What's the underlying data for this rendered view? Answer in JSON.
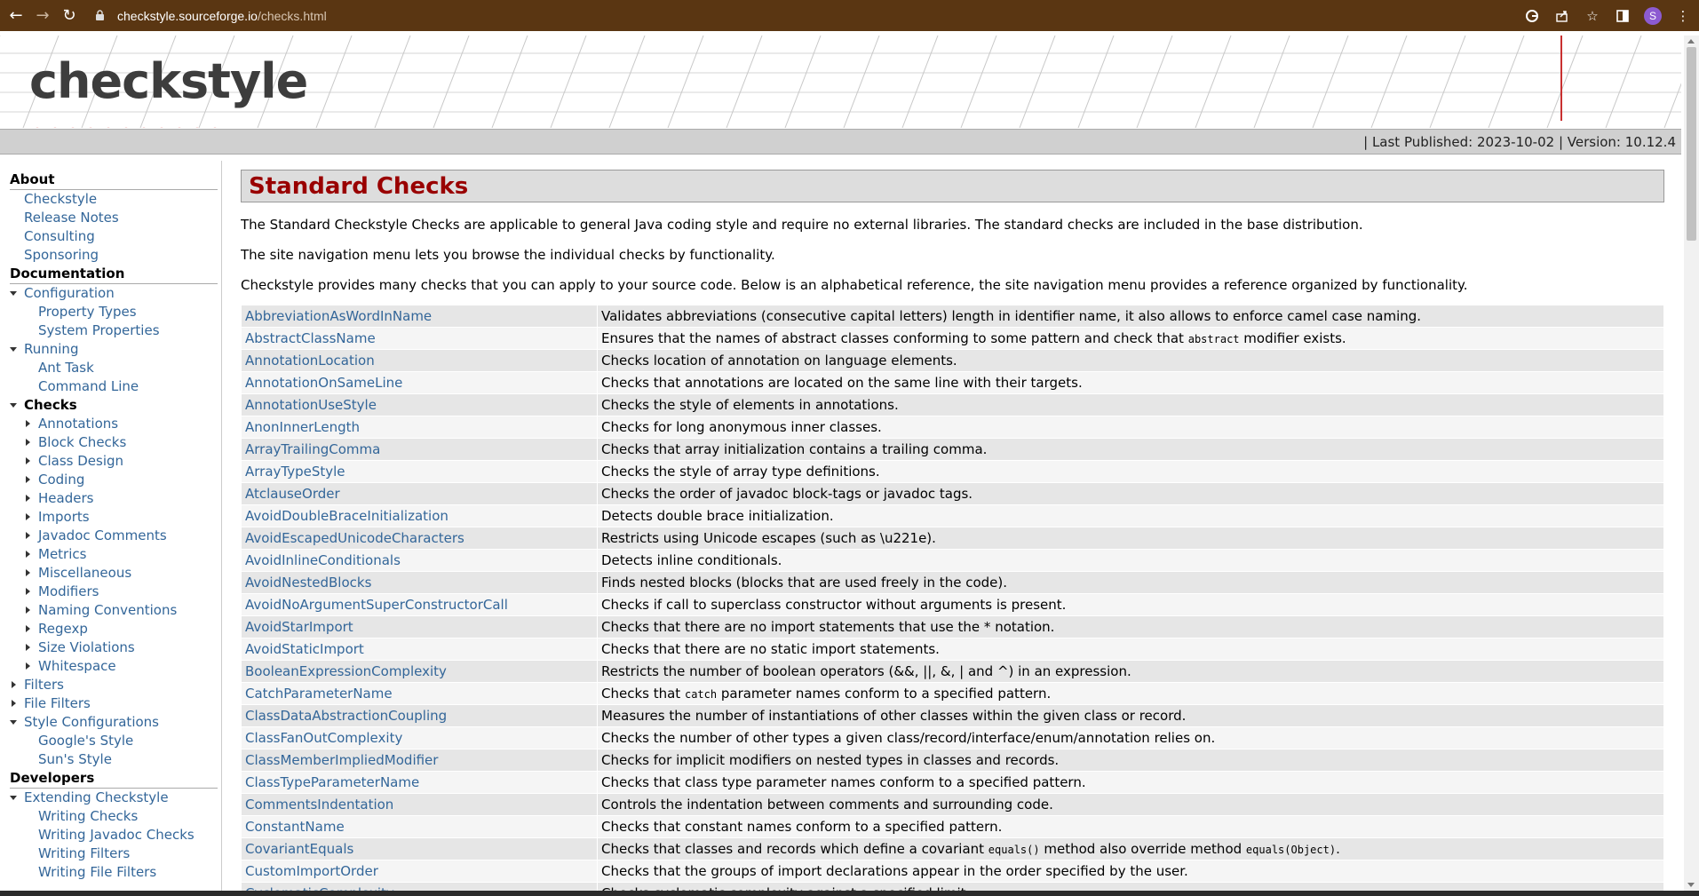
{
  "browser": {
    "url_host": "checkstyle.sourceforge.io",
    "url_path": "/checks.html",
    "avatar_letter": "S"
  },
  "header": {
    "logo_text": "checkstyle",
    "published": "| Last Published: 2023-10-02 | Version: 10.12.4"
  },
  "sidebar": {
    "sections": [
      {
        "title": "About",
        "items": [
          {
            "label": "Checkstyle",
            "level": 1
          },
          {
            "label": "Release Notes",
            "level": 1
          },
          {
            "label": "Consulting",
            "level": 1
          },
          {
            "label": "Sponsoring",
            "level": 1
          }
        ]
      },
      {
        "title": "Documentation",
        "items": [
          {
            "label": "Configuration",
            "level": 1,
            "toggle": "open"
          },
          {
            "label": "Property Types",
            "level": 2
          },
          {
            "label": "System Properties",
            "level": 2
          },
          {
            "label": "Running",
            "level": 1,
            "toggle": "open"
          },
          {
            "label": "Ant Task",
            "level": 2
          },
          {
            "label": "Command Line",
            "level": 2
          },
          {
            "label": "Checks",
            "level": 1,
            "toggle": "open",
            "active": true
          },
          {
            "label": "Annotations",
            "level": 2,
            "toggle": "closed"
          },
          {
            "label": "Block Checks",
            "level": 2,
            "toggle": "closed"
          },
          {
            "label": "Class Design",
            "level": 2,
            "toggle": "closed"
          },
          {
            "label": "Coding",
            "level": 2,
            "toggle": "closed"
          },
          {
            "label": "Headers",
            "level": 2,
            "toggle": "closed"
          },
          {
            "label": "Imports",
            "level": 2,
            "toggle": "closed"
          },
          {
            "label": "Javadoc Comments",
            "level": 2,
            "toggle": "closed"
          },
          {
            "label": "Metrics",
            "level": 2,
            "toggle": "closed"
          },
          {
            "label": "Miscellaneous",
            "level": 2,
            "toggle": "closed"
          },
          {
            "label": "Modifiers",
            "level": 2,
            "toggle": "closed"
          },
          {
            "label": "Naming Conventions",
            "level": 2,
            "toggle": "closed"
          },
          {
            "label": "Regexp",
            "level": 2,
            "toggle": "closed"
          },
          {
            "label": "Size Violations",
            "level": 2,
            "toggle": "closed"
          },
          {
            "label": "Whitespace",
            "level": 2,
            "toggle": "closed"
          },
          {
            "label": "Filters",
            "level": 1,
            "toggle": "closed"
          },
          {
            "label": "File Filters",
            "level": 1,
            "toggle": "closed"
          },
          {
            "label": "Style Configurations",
            "level": 1,
            "toggle": "open"
          },
          {
            "label": "Google's Style",
            "level": 2
          },
          {
            "label": "Sun's Style",
            "level": 2
          }
        ]
      },
      {
        "title": "Developers",
        "items": [
          {
            "label": "Extending Checkstyle",
            "level": 1,
            "toggle": "open"
          },
          {
            "label": "Writing Checks",
            "level": 2
          },
          {
            "label": "Writing Javadoc Checks",
            "level": 2
          },
          {
            "label": "Writing Filters",
            "level": 2
          },
          {
            "label": "Writing File Filters",
            "level": 2
          }
        ]
      }
    ]
  },
  "main": {
    "title": "Standard Checks",
    "intro1": "The Standard Checkstyle Checks are applicable to general Java coding style and require no external libraries. The standard checks are included in the base distribution.",
    "intro2": "The site navigation menu lets you browse the individual checks by functionality.",
    "intro3": "Checkstyle provides many checks that you can apply to your source code. Below is an alphabetical reference, the site navigation menu provides a reference organized by functionality.",
    "checks": [
      {
        "name": "AbbreviationAsWordInName",
        "desc": [
          "Validates abbreviations (consecutive capital letters) length in identifier name, it also allows to enforce camel case naming."
        ]
      },
      {
        "name": "AbstractClassName",
        "desc": [
          "Ensures that the names of abstract classes conforming to some pattern and check that ",
          {
            "code": "abstract"
          },
          " modifier exists."
        ]
      },
      {
        "name": "AnnotationLocation",
        "desc": [
          "Checks location of annotation on language elements."
        ]
      },
      {
        "name": "AnnotationOnSameLine",
        "desc": [
          "Checks that annotations are located on the same line with their targets."
        ]
      },
      {
        "name": "AnnotationUseStyle",
        "desc": [
          "Checks the style of elements in annotations."
        ]
      },
      {
        "name": "AnonInnerLength",
        "desc": [
          "Checks for long anonymous inner classes."
        ]
      },
      {
        "name": "ArrayTrailingComma",
        "desc": [
          "Checks that array initialization contains a trailing comma."
        ]
      },
      {
        "name": "ArrayTypeStyle",
        "desc": [
          "Checks the style of array type definitions."
        ]
      },
      {
        "name": "AtclauseOrder",
        "desc": [
          "Checks the order of javadoc block-tags or javadoc tags."
        ]
      },
      {
        "name": "AvoidDoubleBraceInitialization",
        "desc": [
          "Detects double brace initialization."
        ]
      },
      {
        "name": "AvoidEscapedUnicodeCharacters",
        "desc": [
          "Restricts using Unicode escapes (such as \\u221e)."
        ]
      },
      {
        "name": "AvoidInlineConditionals",
        "desc": [
          "Detects inline conditionals."
        ]
      },
      {
        "name": "AvoidNestedBlocks",
        "desc": [
          "Finds nested blocks (blocks that are used freely in the code)."
        ]
      },
      {
        "name": "AvoidNoArgumentSuperConstructorCall",
        "desc": [
          "Checks if call to superclass constructor without arguments is present."
        ]
      },
      {
        "name": "AvoidStarImport",
        "desc": [
          "Checks that there are no import statements that use the * notation."
        ]
      },
      {
        "name": "AvoidStaticImport",
        "desc": [
          "Checks that there are no static import statements."
        ]
      },
      {
        "name": "BooleanExpressionComplexity",
        "desc": [
          "Restricts the number of boolean operators (&&, ||, &, | and ^) in an expression."
        ]
      },
      {
        "name": "CatchParameterName",
        "desc": [
          "Checks that ",
          {
            "code": "catch"
          },
          " parameter names conform to a specified pattern."
        ]
      },
      {
        "name": "ClassDataAbstractionCoupling",
        "desc": [
          "Measures the number of instantiations of other classes within the given class or record."
        ]
      },
      {
        "name": "ClassFanOutComplexity",
        "desc": [
          "Checks the number of other types a given class/record/interface/enum/annotation relies on."
        ]
      },
      {
        "name": "ClassMemberImpliedModifier",
        "desc": [
          "Checks for implicit modifiers on nested types in classes and records."
        ]
      },
      {
        "name": "ClassTypeParameterName",
        "desc": [
          "Checks that class type parameter names conform to a specified pattern."
        ]
      },
      {
        "name": "CommentsIndentation",
        "desc": [
          "Controls the indentation between comments and surrounding code."
        ]
      },
      {
        "name": "ConstantName",
        "desc": [
          "Checks that constant names conform to a specified pattern."
        ]
      },
      {
        "name": "CovariantEquals",
        "desc": [
          "Checks that classes and records which define a covariant ",
          {
            "code": "equals()"
          },
          " method also override method ",
          {
            "code": "equals(Object)"
          },
          "."
        ]
      },
      {
        "name": "CustomImportOrder",
        "desc": [
          "Checks that the groups of import declarations appear in the order specified by the user."
        ]
      },
      {
        "name": "CyclomaticComplexity",
        "desc": [
          "Checks cyclomatic complexity against a specified limit."
        ]
      }
    ]
  }
}
